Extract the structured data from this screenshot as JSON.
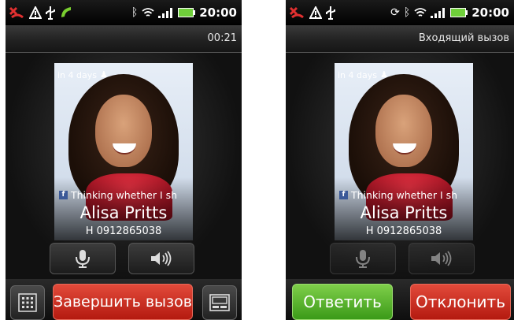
{
  "left_screen": {
    "status_time": "20:00",
    "call_timer": "00:21",
    "reminder": "in 4 days",
    "status_message": "Thinking whether I sh",
    "contact_name": "Alisa Pritts",
    "contact_number": "H 0912865038",
    "end_call_label": "Завершить вызов"
  },
  "right_screen": {
    "status_time": "20:00",
    "call_status": "Входящий вызов",
    "reminder": "in 4 days",
    "status_message": "Thinking whether I sh",
    "contact_name": "Alisa Pritts",
    "contact_number": "H 0912865038",
    "answer_label": "Ответить",
    "decline_label": "Отклонить"
  },
  "colors": {
    "end_call": "#c8281a",
    "answer": "#5ab52c",
    "decline": "#c8281a"
  }
}
